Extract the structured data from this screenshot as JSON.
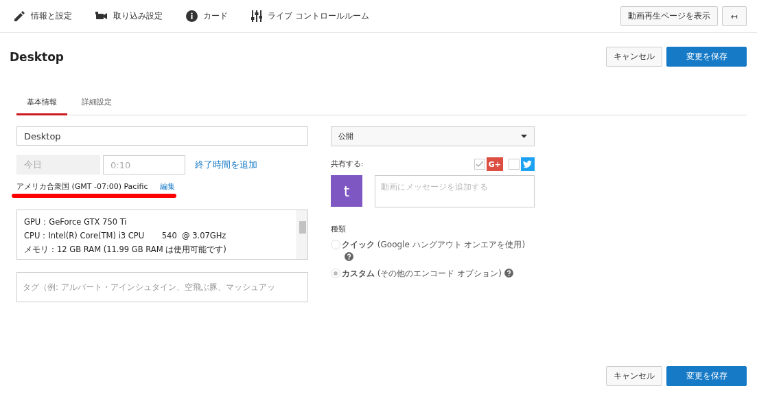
{
  "toolbar": {
    "items": [
      {
        "kind": "pencil",
        "label": "情報と設定"
      },
      {
        "kind": "camera",
        "label": "取り込み設定"
      },
      {
        "kind": "info",
        "label": "カード"
      },
      {
        "kind": "sliders",
        "label": "ライブ コントロールルーム"
      }
    ],
    "view_button": "動画再生ページを表示",
    "back_button": "↤"
  },
  "header": {
    "title": "Desktop",
    "cancel": "キャンセル",
    "save": "変更を保存"
  },
  "tabs": [
    {
      "label": "基本情報",
      "selected": true
    },
    {
      "label": "詳細設定",
      "selected": false
    }
  ],
  "left": {
    "title_value": "Desktop",
    "date_value": "今日",
    "time_placeholder": "0:10",
    "add_end_time": "終了時間を追加",
    "timezone": "アメリカ合衆国 (GMT -07:00) Pacific",
    "edit_link": "編集",
    "description_lines": [
      "GPU：GeForce GTX 750 Ti",
      "CPU：Intel(R) Core(TM) i3 CPU       540  @ 3.07GHz",
      "メモリ：12 GB RAM (11.99 GB RAM は使用可能です)"
    ],
    "tags_placeholder": "タグ（例: アルバート・アインシュタイン、空飛ぶ豚、マッシュアッ"
  },
  "right": {
    "privacy": "公開",
    "share_label": "共有する:",
    "share_targets": [
      {
        "kind": "googleplus",
        "checked": true,
        "label": "G+"
      },
      {
        "kind": "twitter",
        "checked": false
      }
    ],
    "avatar_letter": "t",
    "message_placeholder": "動画にメッセージを追加する",
    "type_label": "種類",
    "types": [
      {
        "label": "**クイック** (Google ハングアウト オンエアを使用)",
        "selected": false
      },
      {
        "label": "**カスタム** (その他のエンコード オプション)",
        "selected": true
      }
    ]
  },
  "footer": {
    "cancel": "キャンセル",
    "save": "変更を保存"
  }
}
